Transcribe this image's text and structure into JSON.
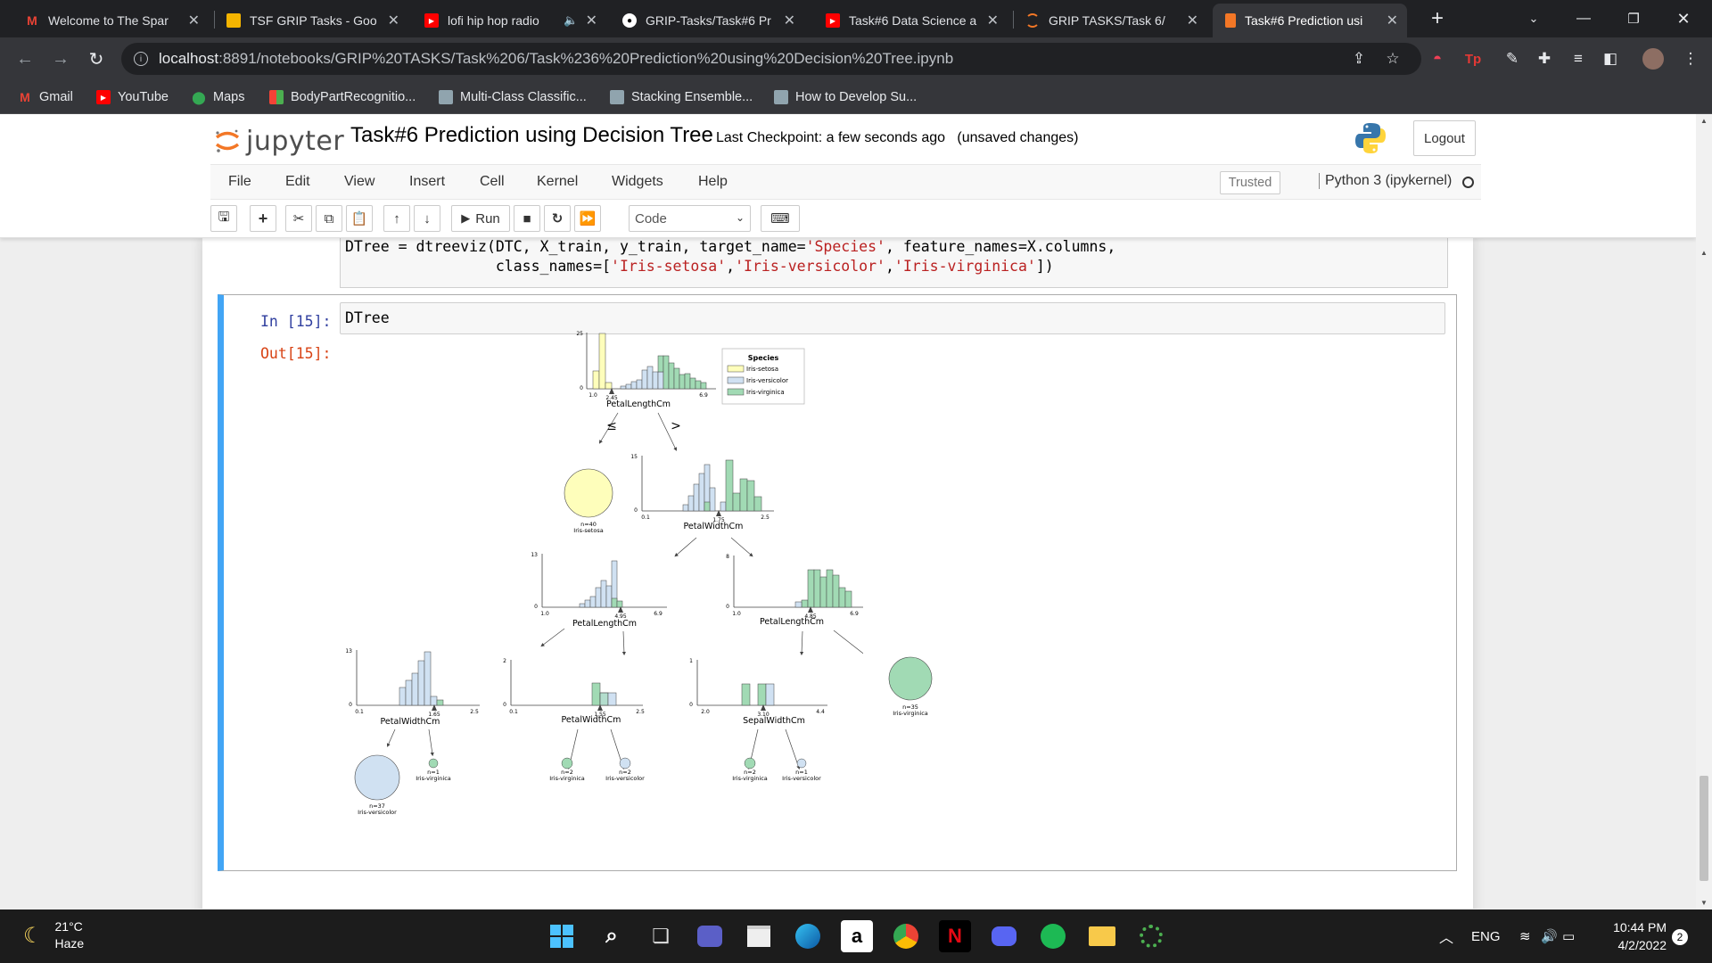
{
  "browser": {
    "tabs": [
      {
        "title": "Welcome to The Spar",
        "icon": "gmail-icon",
        "active": false
      },
      {
        "title": "TSF GRIP Tasks - Goo",
        "icon": "slides-icon",
        "active": false
      },
      {
        "title": "lofi hip hop radio",
        "icon": "youtube-icon",
        "active": false,
        "audio": true
      },
      {
        "title": "GRIP-Tasks/Task#6 Pr",
        "icon": "github-icon",
        "active": false
      },
      {
        "title": "Task#6 Data Science a",
        "icon": "youtube-icon",
        "active": false
      },
      {
        "title": "GRIP TASKS/Task 6/",
        "icon": "jupyter-icon",
        "active": false
      },
      {
        "title": "Task#6 Prediction usi",
        "icon": "notebook-icon",
        "active": true
      }
    ],
    "new_tab": "+",
    "url_host": "localhost",
    "url_path": ":8891/notebooks/GRIP%20TASKS/Task%206/Task%236%20Prediction%20using%20Decision%20Tree.ipynb",
    "bookmarks": [
      {
        "label": "Gmail",
        "icon": "gmail-icon"
      },
      {
        "label": "YouTube",
        "icon": "youtube-icon"
      },
      {
        "label": "Maps",
        "icon": "maps-icon"
      },
      {
        "label": "BodyPartRecognitio...",
        "icon": "app-icon"
      },
      {
        "label": "Multi-Class Classific...",
        "icon": "page-icon"
      },
      {
        "label": "Stacking Ensemble...",
        "icon": "page-icon"
      },
      {
        "label": "How to Develop Su...",
        "icon": "page-icon"
      }
    ]
  },
  "jupyter": {
    "logo_text": "jupyter",
    "notebook_title": "Task#6 Prediction using Decision Tree",
    "checkpoint": "Last Checkpoint: a few seconds ago",
    "unsaved": "(unsaved changes)",
    "logout": "Logout",
    "menu": [
      "File",
      "Edit",
      "View",
      "Insert",
      "Cell",
      "Kernel",
      "Widgets",
      "Help"
    ],
    "trusted": "Trusted",
    "kernel": "Python 3 (ipykernel)",
    "run_label": "Run",
    "cell_type": "Code"
  },
  "cells": {
    "prev_line1_a": "DTree = dtreeviz(DTC, X_train, y_train, target_name=",
    "prev_line1_str": "'Species'",
    "prev_line1_b": ", feature_names=X.columns,",
    "prev_line2_a": "                 class_names=[",
    "prev_line2_s1": "'Iris-setosa'",
    "prev_line2_c1": ",",
    "prev_line2_s2": "'Iris-versicolor'",
    "prev_line2_c2": ",",
    "prev_line2_s3": "'Iris-virginica'",
    "prev_line2_b": "])",
    "in_prompt": "In [15]:",
    "out_prompt": "Out[15]:",
    "input_code": "DTree"
  },
  "tree": {
    "legend_title": "Species",
    "classes": [
      "Iris-setosa",
      "Iris-versicolor",
      "Iris-virginica"
    ],
    "colors": {
      "setosa": "#fefebb",
      "versicolor": "#d0e1f2",
      "virginica": "#a1dab4",
      "edge": "#444444"
    },
    "root": {
      "feature": "PetalLengthCm",
      "ymax": "25",
      "ymin": "0",
      "xmin": "1.0",
      "split": "2.45",
      "xmax": "6.9",
      "left_arrow": "≤",
      "right_arrow": ">"
    },
    "n1": {
      "feature": "PetalWidthCm",
      "ymax": "15",
      "ymin": "0",
      "xmin": "0.1",
      "split": "1.75",
      "xmax": "2.5"
    },
    "leaf_setosa": {
      "n": "n=40",
      "label": "Iris-setosa"
    },
    "n2": {
      "feature": "PetalLengthCm",
      "ymax": "13",
      "ymin": "0",
      "xmin": "1.0",
      "split": "4.95",
      "xmax": "6.9"
    },
    "n3": {
      "feature": "PetalLengthCm",
      "ymax": "8",
      "ymin": "0",
      "xmin": "1.0",
      "split": "4.85",
      "xmax": "6.9"
    },
    "n4": {
      "feature": "PetalWidthCm",
      "ymax": "13",
      "ymin": "0",
      "xmin": "0.1",
      "split": "1.65",
      "xmax": "2.5"
    },
    "n5": {
      "feature": "PetalWidthCm",
      "ymax": "2",
      "ymin": "0",
      "xmin": "0.1",
      "split": "1.55",
      "xmax": "2.5"
    },
    "n6": {
      "feature": "SepalWidthCm",
      "ymax": "1",
      "ymin": "0",
      "xmin": "2.0",
      "split": "3.10",
      "xmax": "4.4"
    },
    "leaf_v35": {
      "n": "n=35",
      "label": "Iris-virginica"
    },
    "leaf_vc37": {
      "n": "n=37",
      "label": "Iris-versicolor"
    },
    "leaf_v1a": {
      "n": "n=1",
      "label": "Iris-virginica"
    },
    "leaf_v2a": {
      "n": "n=2",
      "label": "Iris-virginica"
    },
    "leaf_vc2": {
      "n": "n=2",
      "label": "Iris-versicolor"
    },
    "leaf_v2b": {
      "n": "n=2",
      "label": "Iris-virginica"
    },
    "leaf_vc1": {
      "n": "n=1",
      "label": "Iris-versicolor"
    }
  },
  "taskbar": {
    "temp": "21°C",
    "weather": "Haze",
    "lang": "ENG",
    "time": "10:44 PM",
    "date": "4/2/2022",
    "notifications": "2",
    "apps": [
      "start-icon",
      "search-icon",
      "task-view-icon",
      "chat-icon",
      "store-icon",
      "edge-icon",
      "amazon-icon",
      "chrome-icon",
      "netflix-icon",
      "discord-icon",
      "spotify-icon",
      "explorer-icon",
      "loading-icon"
    ]
  }
}
